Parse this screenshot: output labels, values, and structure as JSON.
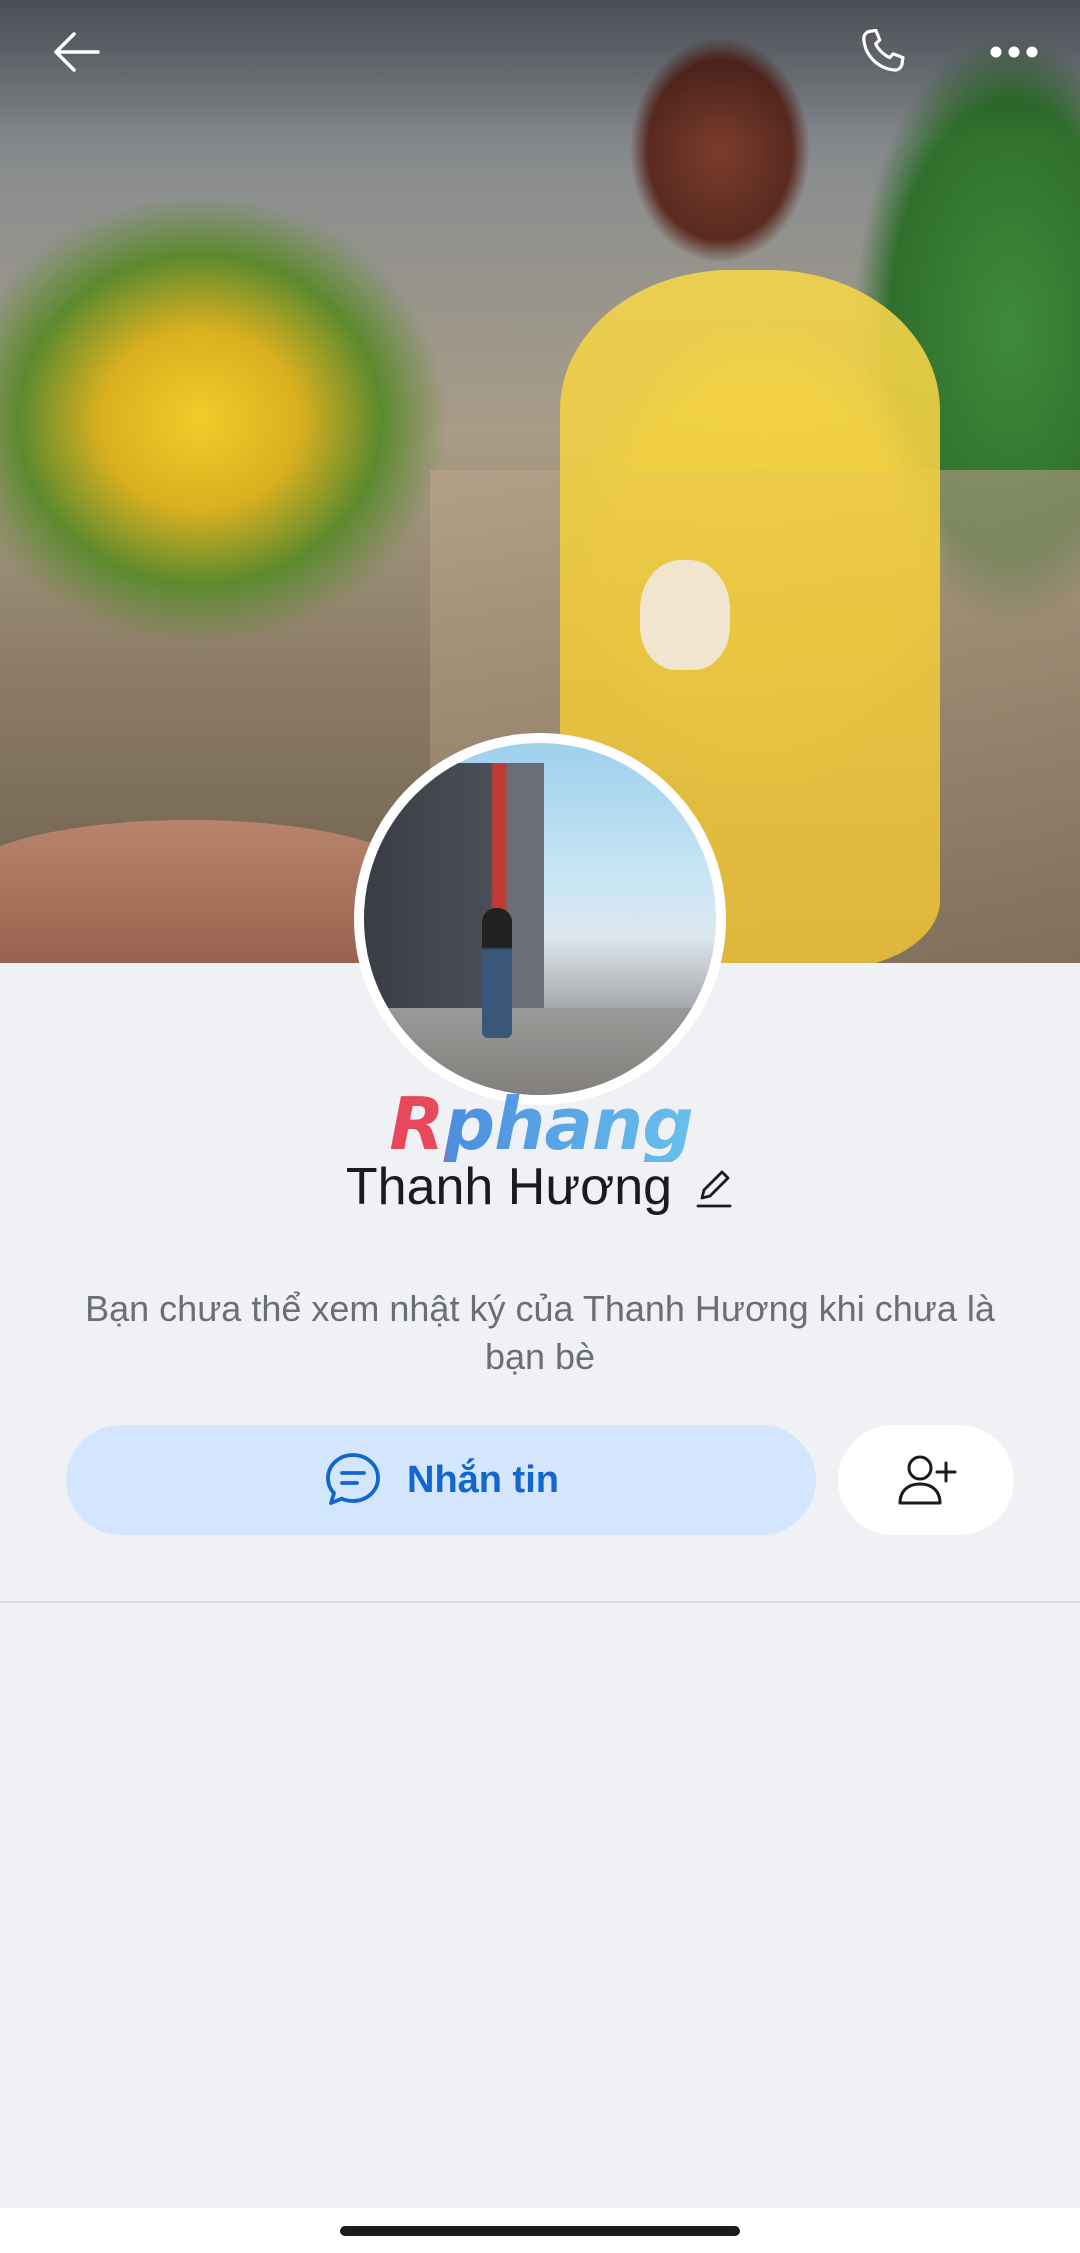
{
  "header": {
    "back_icon": "arrow-left-icon",
    "call_icon": "phone-icon",
    "more_icon": "more-horizontal-icon"
  },
  "profile": {
    "watermark_logo": "Rphang",
    "name": "Thanh Hương",
    "edit_icon": "pencil-icon",
    "privacy_notice": "Bạn chưa thể xem nhật ký của Thanh Hương khi chưa là bạn bè"
  },
  "actions": {
    "message_label": "Nhắn tin",
    "message_icon": "chat-bubble-icon",
    "add_friend_icon": "add-friend-icon"
  },
  "colors": {
    "accent": "#1366cc",
    "message_button_bg": "#d4e6fd",
    "page_bg": "#f0f1f5"
  }
}
